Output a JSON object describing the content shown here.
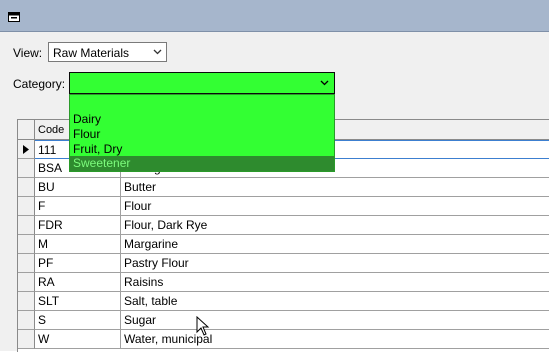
{
  "window": {
    "icon": "form-icon"
  },
  "filters": {
    "view_label": "View:",
    "view_value": "Raw Materials",
    "category_label": "Category:",
    "category_value": ""
  },
  "dropdown": {
    "options": [
      "Dairy",
      "Flour",
      "Fruit, Dry",
      "Sweetener"
    ],
    "highlighted": "Sweetener"
  },
  "grid": {
    "columns": [
      "Code",
      ""
    ],
    "rows": [
      {
        "code": "111",
        "desc": ""
      },
      {
        "code": "BSA",
        "desc": "Baking Soda"
      },
      {
        "code": "BU",
        "desc": "Butter"
      },
      {
        "code": "F",
        "desc": "Flour"
      },
      {
        "code": "FDR",
        "desc": "Flour, Dark Rye"
      },
      {
        "code": "M",
        "desc": "Margarine"
      },
      {
        "code": "PF",
        "desc": "Pastry Flour"
      },
      {
        "code": "RA",
        "desc": "Raisins"
      },
      {
        "code": "SLT",
        "desc": "Salt, table"
      },
      {
        "code": "S",
        "desc": "Sugar"
      },
      {
        "code": "W",
        "desc": "Water, municipal"
      }
    ]
  },
  "colors": {
    "accent": "#33ff33",
    "highlight": "#2e8b2e",
    "titlebar": "#a6b6cc"
  }
}
